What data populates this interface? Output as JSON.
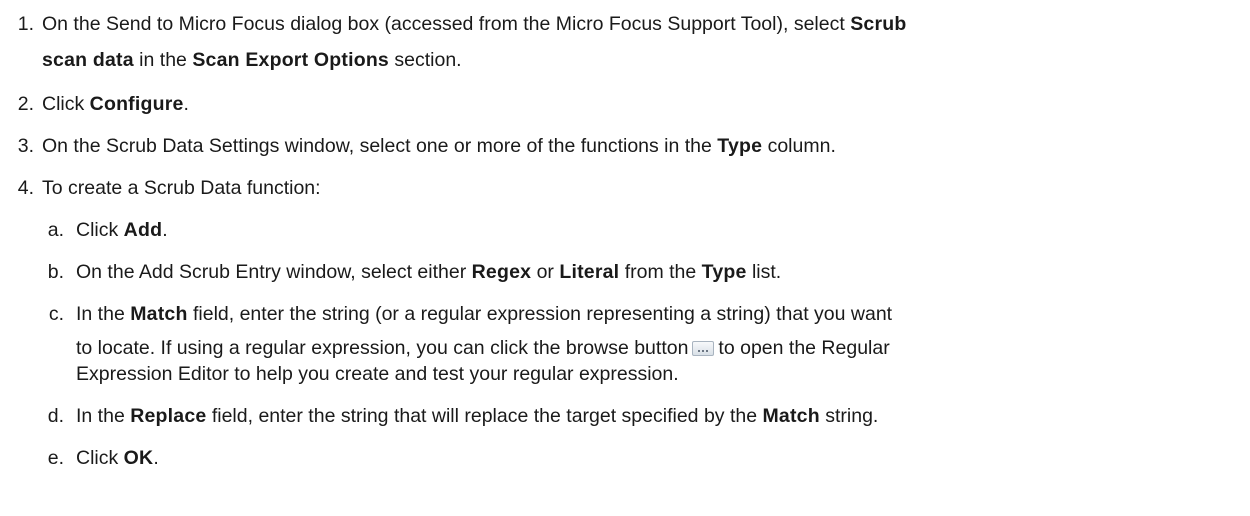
{
  "steps": [
    {
      "num": "1.",
      "l1a": "On the Send to Micro Focus dialog box (accessed from the Micro Focus Support Tool), select ",
      "l1b": "Scrub",
      "l2a": "scan data",
      "l2b": " in the ",
      "l2c": "Scan Export Options",
      "l2d": " section."
    },
    {
      "num": "2.",
      "a": "Click ",
      "b": "Configure",
      "c": "."
    },
    {
      "num": "3.",
      "a": "On the Scrub Data Settings window, select one or more of the functions in the ",
      "b": "Type",
      "c": " column."
    },
    {
      "num": "4.",
      "a": "To create a Scrub Data function:"
    }
  ],
  "substeps": [
    {
      "num": "a.",
      "a": "Click ",
      "b": "Add",
      "c": "."
    },
    {
      "num": "b.",
      "a": "On the Add Scrub Entry window, select either ",
      "b": "Regex",
      "c": " or ",
      "d": "Literal",
      "e": " from the ",
      "f": "Type",
      "g": " list."
    },
    {
      "num": "c.",
      "l1a": "In the ",
      "l1b": "Match",
      "l1c": " field, enter the string (or a regular expression representing a string) that you want",
      "l2a": "to locate. If using a regular expression, you can click the browse button",
      "l2b": "to open the Regular",
      "l3": "Expression Editor to help you create and test your regular expression."
    },
    {
      "num": "d.",
      "a": "In the ",
      "b": "Replace",
      "c": " field, enter the string that will replace the target specified by the ",
      "d": "Match",
      "e": " string."
    },
    {
      "num": "e.",
      "a": "Click ",
      "b": "OK",
      "c": "."
    }
  ],
  "icons": {
    "browse": "browse-button-icon"
  }
}
